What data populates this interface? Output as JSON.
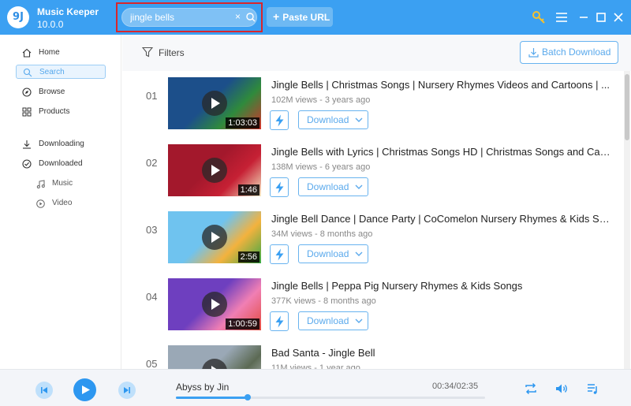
{
  "app": {
    "logo_text": "9J",
    "name": "Music Keeper",
    "version": "10.0.0"
  },
  "search": {
    "value": "jingle bells",
    "placeholder": "",
    "clear_symbol": "×"
  },
  "toolbar": {
    "paste_url_label": "Paste URL",
    "paste_plus": "+"
  },
  "sidebar": {
    "items": [
      {
        "label": "Home",
        "icon": "home-icon",
        "active": false
      },
      {
        "label": "Search",
        "icon": "search-icon",
        "active": true
      },
      {
        "label": "Browse",
        "icon": "compass-icon",
        "active": false
      },
      {
        "label": "Products",
        "icon": "grid-icon",
        "active": false
      },
      {
        "label": "Downloading",
        "icon": "download-icon",
        "active": false
      },
      {
        "label": "Downloaded",
        "icon": "check-circle-icon",
        "active": false
      }
    ],
    "sub_items": [
      {
        "label": "Music",
        "icon": "music-note-icon"
      },
      {
        "label": "Video",
        "icon": "play-circle-icon"
      }
    ]
  },
  "filters": {
    "label": "Filters"
  },
  "batch_download": {
    "label": "Batch Download"
  },
  "results": [
    {
      "index": "01",
      "title": "Jingle Bells | Christmas Songs | Nursery Rhymes Videos and Cartoons | ...",
      "meta": "102M views - 3 years ago",
      "duration": "1:03:03",
      "download_label": "Download",
      "theme": [
        "#1c4f8a",
        "#2f8a3c",
        "#d4322b"
      ]
    },
    {
      "index": "02",
      "title": "Jingle Bells with Lyrics | Christmas Songs HD | Christmas Songs and Carols",
      "meta": "138M views - 6 years ago",
      "duration": "1:46",
      "download_label": "Download",
      "theme": [
        "#a3182c",
        "#c62034",
        "#f4e9c4"
      ]
    },
    {
      "index": "03",
      "title": "Jingle Bell Dance | Dance Party | CoComelon Nursery Rhymes & Kids Songs",
      "meta": "34M views - 8 months ago",
      "duration": "2:56",
      "download_label": "Download",
      "theme": [
        "#6fc3ef",
        "#f3b23e",
        "#39a845"
      ]
    },
    {
      "index": "04",
      "title": "Jingle Bells | Peppa Pig Nursery Rhymes & Kids Songs",
      "meta": "377K views - 8 months ago",
      "duration": "1:00:59",
      "download_label": "Download",
      "theme": [
        "#6e3fbf",
        "#f07fb4",
        "#e24a3d"
      ]
    },
    {
      "index": "05",
      "title": "Bad Santa - Jingle Bell",
      "meta": "11M views - 1 year ago",
      "duration": "",
      "download_label": "Download",
      "theme": [
        "#9aa8b6",
        "#5c6a54",
        "#c9cfd4"
      ]
    }
  ],
  "player": {
    "track": "Abyss by Jin",
    "time": "00:34/02:35",
    "progress": 0.233
  },
  "colors": {
    "accent": "#3ba0f2",
    "highlight": "#d9262c"
  }
}
